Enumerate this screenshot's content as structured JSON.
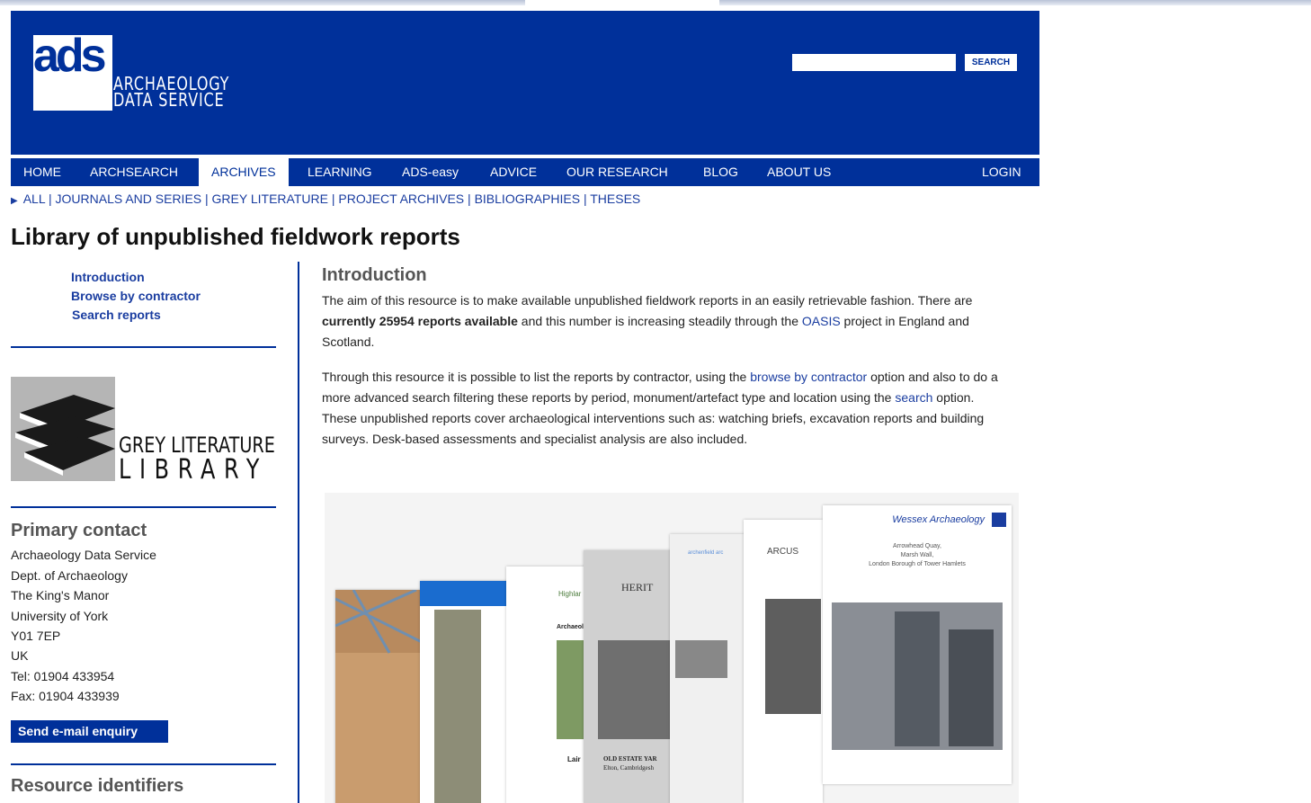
{
  "header": {
    "logo_mark": "ads",
    "logo_line1": "ARCHAEOLOGY",
    "logo_line2": "DATA SERVICE",
    "search_value": "",
    "search_button": "SEARCH"
  },
  "nav": {
    "items": [
      {
        "label": "HOME"
      },
      {
        "label": "ARCHSEARCH"
      },
      {
        "label": "ARCHIVES",
        "active": true
      },
      {
        "label": "LEARNING"
      },
      {
        "label": "ADS-easy"
      },
      {
        "label": "ADVICE"
      },
      {
        "label": "OUR RESEARCH"
      },
      {
        "label": "BLOG"
      },
      {
        "label": "ABOUT US"
      },
      {
        "label": "LOGIN"
      }
    ]
  },
  "subnav": {
    "items": [
      "ALL",
      "JOURNALS AND SERIES",
      "GREY LITERATURE",
      "PROJECT ARCHIVES",
      "BIBLIOGRAPHIES",
      "THESES"
    ]
  },
  "page": {
    "title": "Library of unpublished fieldwork reports"
  },
  "sidebar": {
    "links": [
      "Introduction",
      "Browse by contractor",
      "Search reports"
    ],
    "gl_logo_line1": "GREY LITERATURE",
    "gl_logo_line2": "LIBRARY",
    "contact_heading": "Primary contact",
    "contact_lines": [
      "Archaeology Data Service",
      "Dept. of Archaeology",
      "The King's Manor",
      "University of York",
      "Y01 7EP",
      "UK",
      "Tel: 01904 433954",
      "Fax: 01904 433939"
    ],
    "email_button": "Send e-mail enquiry",
    "resource_heading": "Resource identifiers"
  },
  "main": {
    "intro_heading": "Introduction",
    "p1": {
      "a": "The aim of this resource is to make available unpublished fieldwork reports in an easily retrievable fashion. There are ",
      "b": "currently 25954 reports available",
      "c": " and this number is increasing steadily through the ",
      "link": "OASIS",
      "d": " project in England and Scotland."
    },
    "p2": {
      "a": "Through this resource it is possible to list the reports by contractor, using the ",
      "link1": "browse by contractor",
      "b": " option and also to do a more advanced search filtering these reports by period, monument/artefact type and location using the ",
      "link2": "search",
      "c": " option. These unpublished reports cover archaeological interventions such as: watching briefs, excavation reports and building surveys. Desk-based assessments and specialist analysis are also included."
    },
    "collage": {
      "wessex_title": "Wessex Archaeology",
      "wessex_sub1": "Arrowhead Quay,",
      "wessex_sub2": "Marsh Wall,",
      "wessex_sub3": "London Borough of Tower Hamlets",
      "arcus": "ARCUS",
      "herit": "HERIT",
      "highlar": "Highlar",
      "archaeol": "Archaeol",
      "lair": "Lair",
      "old_estate": "OLD ESTATE YAR",
      "elton": "Elton, Cambridgesh",
      "archenfield": "archenfield arc"
    }
  }
}
